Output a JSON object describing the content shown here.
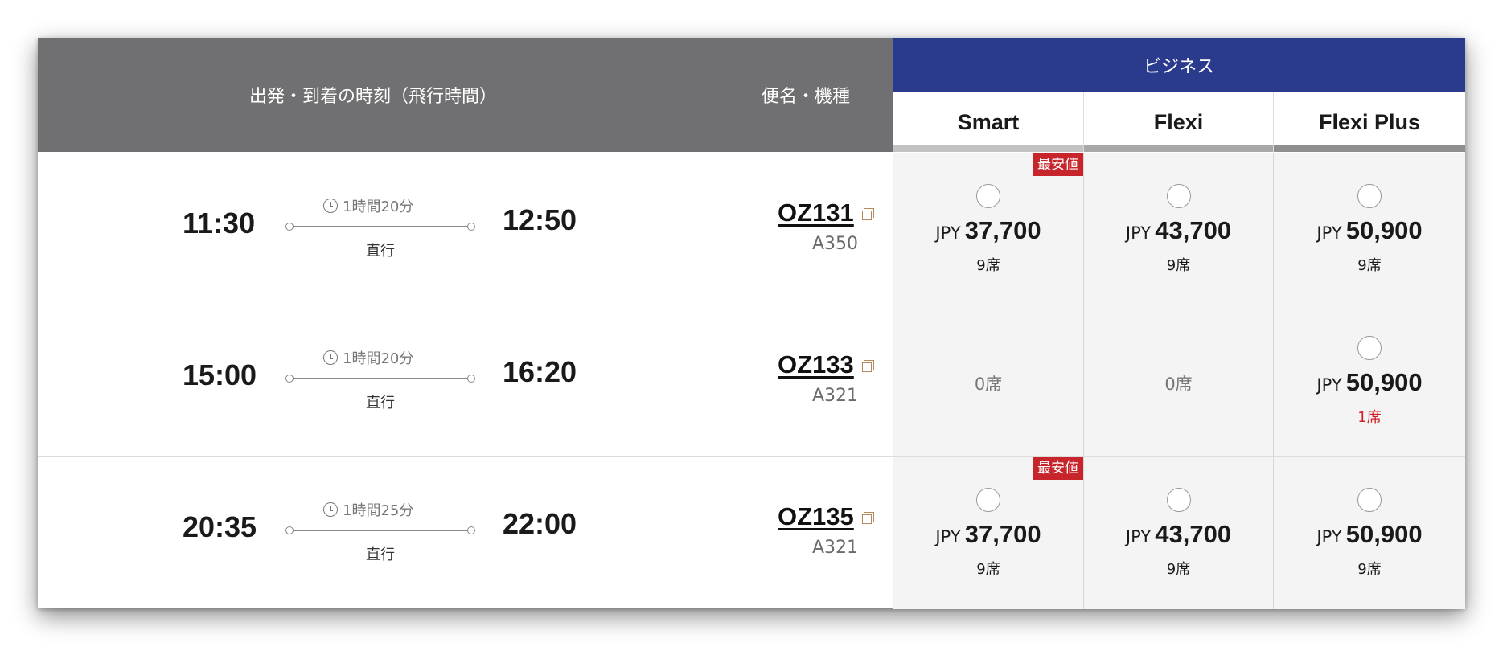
{
  "header": {
    "time_col": "出発・到着の時刻（飛行時間）",
    "flight_col": "便名・機種",
    "cabin": "ビジネス",
    "cabin_color": "#2a3a8c",
    "fares": [
      {
        "label": "Smart",
        "bar_color": "#c2c2c2"
      },
      {
        "label": "Flexi",
        "bar_color": "#a8a8a8"
      },
      {
        "label": "Flexi Plus",
        "bar_color": "#8f8f8f"
      }
    ]
  },
  "flights": [
    {
      "departure": "11:30",
      "arrival": "12:50",
      "duration": "1時間20分",
      "stops": "直行",
      "flight_no": "OZ131",
      "aircraft": "A350",
      "fares": [
        {
          "currency": "JPY",
          "amount": "37,700",
          "seats": "9席",
          "badge": "最安値"
        },
        {
          "currency": "JPY",
          "amount": "43,700",
          "seats": "9席"
        },
        {
          "currency": "JPY",
          "amount": "50,900",
          "seats": "9席"
        }
      ]
    },
    {
      "departure": "15:00",
      "arrival": "16:20",
      "duration": "1時間20分",
      "stops": "直行",
      "flight_no": "OZ133",
      "aircraft": "A321",
      "fares": [
        {
          "sold_out": "0席"
        },
        {
          "sold_out": "0席"
        },
        {
          "currency": "JPY",
          "amount": "50,900",
          "seats": "1席",
          "low": true
        }
      ]
    },
    {
      "departure": "20:35",
      "arrival": "22:00",
      "duration": "1時間25分",
      "stops": "直行",
      "flight_no": "OZ135",
      "aircraft": "A321",
      "fares": [
        {
          "currency": "JPY",
          "amount": "37,700",
          "seats": "9席",
          "badge": "最安値"
        },
        {
          "currency": "JPY",
          "amount": "43,700",
          "seats": "9席"
        },
        {
          "currency": "JPY",
          "amount": "50,900",
          "seats": "9席"
        }
      ]
    }
  ]
}
